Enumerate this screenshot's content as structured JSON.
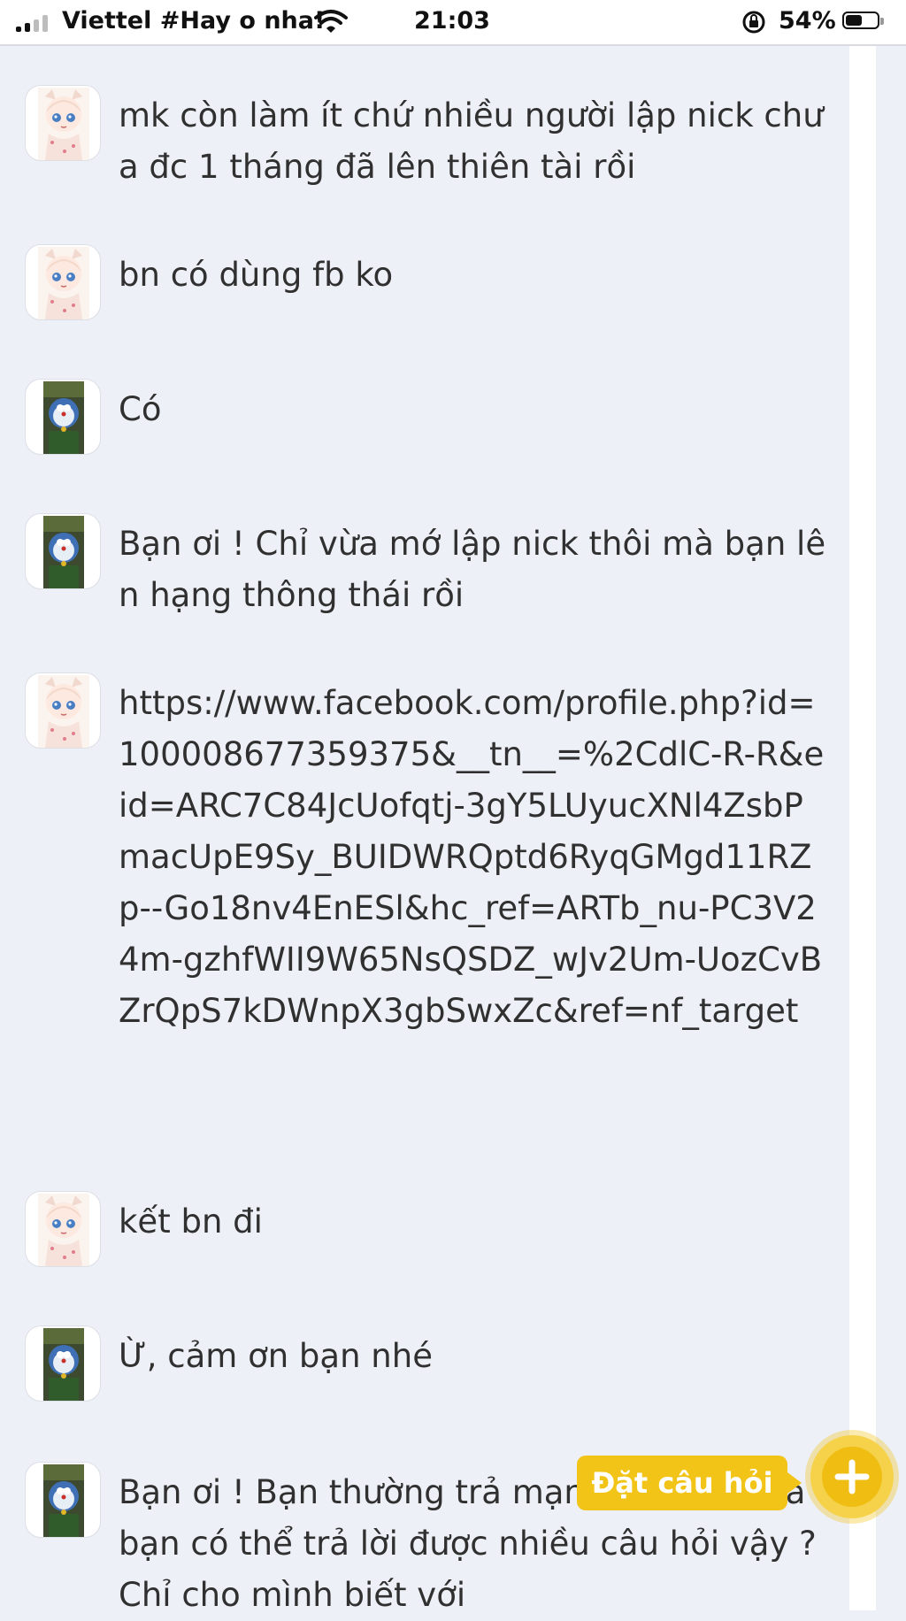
{
  "status_bar": {
    "carrier": "Viettel #Hay o nha!",
    "time": "21:03",
    "battery": "54%"
  },
  "comments": [
    {
      "avatar": "anime-girl-avatar",
      "text": "mk còn làm ít chứ nhiều người lập nick chưa đc 1 tháng đã lên thiên tài rồi"
    },
    {
      "avatar": "anime-girl-avatar",
      "text": "bn có dùng fb ko"
    },
    {
      "avatar": "doraemon-avatar",
      "text": "Có"
    },
    {
      "avatar": "doraemon-avatar",
      "text": "Bạn ơi ! Chỉ vừa mớ lập nick thôi mà bạn lên hạng thông thái rồi"
    },
    {
      "avatar": "anime-girl-avatar",
      "text": "https://www.facebook.com/profile.php?id=100008677359375&__tn__=%2CdlC-R-R&eid=ARC7C84JcUofqtj-3gY5LUyucXNl4ZsbPmacUpE9Sy_BUIDWRQptd6RyqGMgd11RZp--Go18nv4EnESl&hc_ref=ARTb_nu-PC3V24m-gzhfWII9W65NsQSDZ_wJv2Um-UozCvBZrQpS7kDWnpX3gbSwxZc&ref=nf_target"
    },
    {
      "avatar": "anime-girl-avatar",
      "text": "kết bn đi"
    },
    {
      "avatar": "doraemon-avatar",
      "text": "Ừ, cảm ơn bạn nhé"
    },
    {
      "avatar": "doraemon-avatar",
      "text": "Bạn ơi ! Bạn thường trả mạng … o thế mà bạn có thể trả lời được nhiều câu hỏi vậy ? Chỉ cho mình biết với"
    }
  ],
  "ask_button": {
    "label": "Đặt câu hỏi",
    "color": "#f2c417"
  }
}
